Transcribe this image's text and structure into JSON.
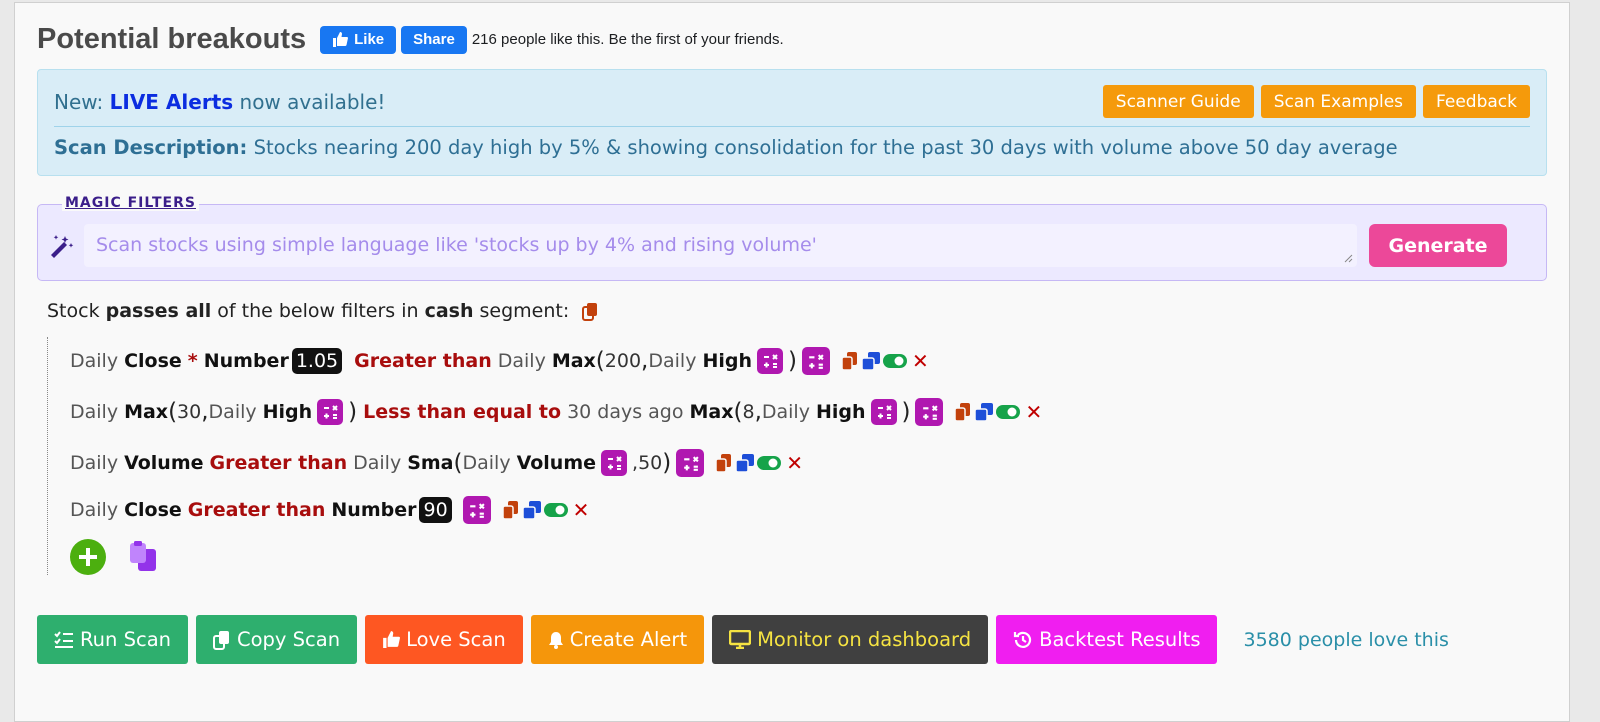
{
  "header": {
    "title": "Potential breakouts",
    "like_label": "Like",
    "share_label": "Share",
    "like_count_text": "216 people like this. Be the first of your friends."
  },
  "info": {
    "new_prefix": "New:",
    "live_alerts": "LIVE Alerts",
    "new_suffix": "now available!",
    "buttons": [
      "Scanner Guide",
      "Scan Examples",
      "Feedback"
    ],
    "desc_label": "Scan Description:",
    "desc_text": "Stocks nearing 200 day high by 5% & showing consolidation for the past 30 days with volume above 50 day average"
  },
  "magic": {
    "legend": "MAGIC FILTERS",
    "placeholder": "Scan stocks using simple language like 'stocks up by 4% and rising volume'",
    "generate_label": "Generate"
  },
  "pass_line": {
    "prefix": "Stock",
    "passes": "passes all",
    "middle": "of the below filters in",
    "segment": "cash",
    "suffix": "segment:"
  },
  "filters": [
    {
      "daily": "Daily",
      "close": "Close",
      "times": "*",
      "number": "Number",
      "value": "1.05",
      "op": "Greater than",
      "daily2": "Daily",
      "func": "Max",
      "arg": "200",
      "comma": ",",
      "daily3": "Daily",
      "field": "High"
    },
    {
      "daily": "Daily",
      "func": "Max",
      "arg": "30",
      "comma": ",",
      "daily2": "Daily",
      "field": "High",
      "op": "Less than equal to",
      "ago": "30 days ago",
      "func2": "Max",
      "arg2": "8",
      "comma2": ",",
      "daily3": "Daily",
      "field2": "High"
    },
    {
      "daily": "Daily",
      "field": "Volume",
      "op": "Greater than",
      "daily2": "Daily",
      "func": "Sma",
      "daily3": "Daily",
      "field2": "Volume",
      "arg": ",50"
    },
    {
      "daily": "Daily",
      "close": "Close",
      "op": "Greater than",
      "number": "Number",
      "value": "90"
    }
  ],
  "bottom": {
    "run": "Run Scan",
    "copy": "Copy Scan",
    "love": "Love Scan",
    "alert": "Create Alert",
    "monitor": "Monitor on dashboard",
    "backtest": "Backtest Results",
    "love_count": "3580 people love this"
  },
  "colors": {
    "accent_orange": "#f59a0b",
    "generate_pink": "#ec4899",
    "operator_red": "#a80d0d",
    "calc_purple": "#b018b0",
    "run_green": "#2eaf6e"
  }
}
